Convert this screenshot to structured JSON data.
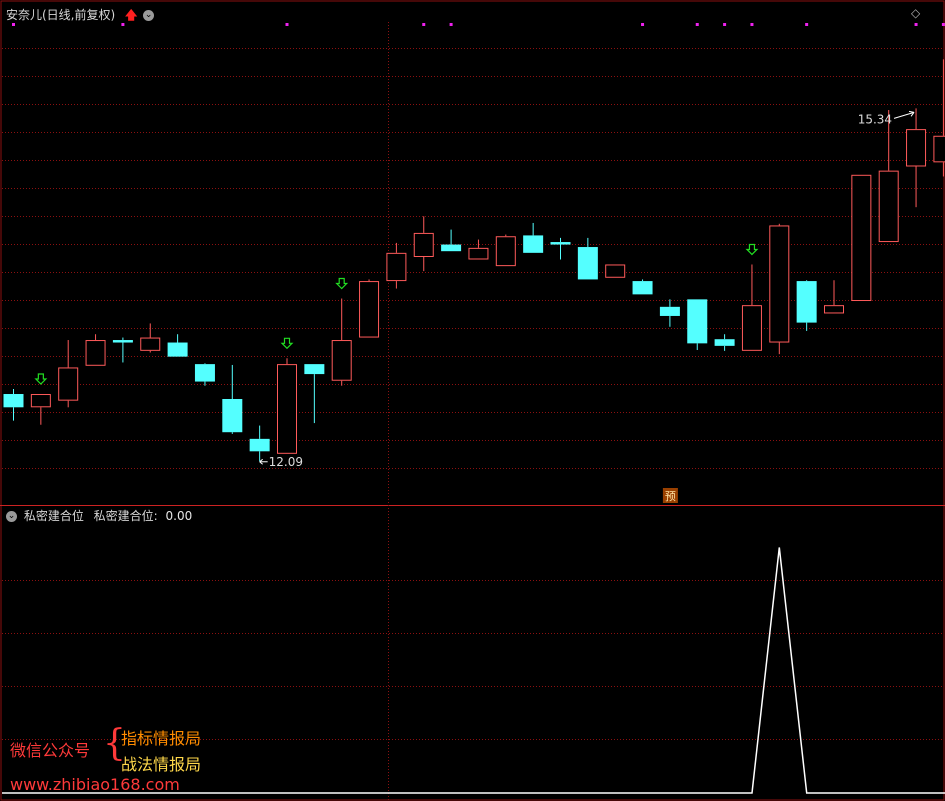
{
  "window": {
    "title": "安奈儿(日线,前复权)"
  },
  "indicator": {
    "name": "私密建合位",
    "value_label": "私密建合位:",
    "value": "0.00"
  },
  "colors": {
    "up": "#ff5a5a",
    "down": "#54ffff",
    "grid": "#8c1010",
    "signal": "#22dd22",
    "dot": "#ee22ee",
    "indicator_line": "#ffffff",
    "forecast_bg": "#9a4000",
    "forecast_fg": "#ffe0a0"
  },
  "chart_data": [
    {
      "type": "candlestick",
      "title": "安奈儿(日线,前复权)",
      "series": [
        {
          "o": 12.9,
          "c": 12.74,
          "h": 12.96,
          "l": 12.58
        },
        {
          "o": 12.74,
          "c": 12.9,
          "h": 12.9,
          "l": 12.53
        },
        {
          "o": 12.82,
          "c": 13.22,
          "h": 13.55,
          "l": 12.74
        },
        {
          "o": 13.24,
          "c": 13.55,
          "h": 13.62,
          "l": 13.24
        },
        {
          "o": 13.55,
          "c": 13.52,
          "h": 13.58,
          "l": 13.28
        },
        {
          "o": 13.42,
          "c": 13.58,
          "h": 13.75,
          "l": 13.4
        },
        {
          "o": 13.52,
          "c": 13.35,
          "h": 13.62,
          "l": 13.35
        },
        {
          "o": 13.26,
          "c": 13.05,
          "h": 13.27,
          "l": 13.0
        },
        {
          "o": 12.84,
          "c": 12.44,
          "h": 13.25,
          "l": 12.42
        },
        {
          "o": 12.36,
          "c": 12.21,
          "h": 12.52,
          "l": 12.09
        },
        {
          "o": 12.18,
          "c": 13.26,
          "h": 13.33,
          "l": 12.18
        },
        {
          "o": 13.26,
          "c": 13.14,
          "h": 13.26,
          "l": 12.55
        },
        {
          "o": 13.06,
          "c": 13.55,
          "h": 14.05,
          "l": 13.0
        },
        {
          "o": 13.58,
          "c": 14.26,
          "h": 14.28,
          "l": 13.58
        },
        {
          "o": 14.26,
          "c": 14.6,
          "h": 14.72,
          "l": 14.17
        },
        {
          "o": 14.55,
          "c": 14.84,
          "h": 15.04,
          "l": 14.38
        },
        {
          "o": 14.7,
          "c": 14.62,
          "h": 14.88,
          "l": 14.62
        },
        {
          "o": 14.52,
          "c": 14.66,
          "h": 14.76,
          "l": 14.52
        },
        {
          "o": 14.44,
          "c": 14.8,
          "h": 14.82,
          "l": 14.44
        },
        {
          "o": 14.81,
          "c": 14.6,
          "h": 14.96,
          "l": 14.6
        },
        {
          "o": 14.73,
          "c": 14.7,
          "h": 14.78,
          "l": 14.52
        },
        {
          "o": 14.67,
          "c": 14.28,
          "h": 14.78,
          "l": 14.28
        },
        {
          "o": 14.3,
          "c": 14.46,
          "h": 14.46,
          "l": 14.3
        },
        {
          "o": 14.26,
          "c": 14.1,
          "h": 14.28,
          "l": 14.1
        },
        {
          "o": 13.95,
          "c": 13.84,
          "h": 14.04,
          "l": 13.71
        },
        {
          "o": 14.04,
          "c": 13.51,
          "h": 14.04,
          "l": 13.43
        },
        {
          "o": 13.56,
          "c": 13.48,
          "h": 13.62,
          "l": 13.42
        },
        {
          "o": 13.42,
          "c": 13.97,
          "h": 14.46,
          "l": 13.42
        },
        {
          "o": 13.52,
          "c": 14.93,
          "h": 14.95,
          "l": 13.38
        },
        {
          "o": 14.26,
          "c": 13.76,
          "h": 14.27,
          "l": 13.66
        },
        {
          "o": 13.87,
          "c": 13.97,
          "h": 14.27,
          "l": 13.87
        },
        {
          "o": 14.02,
          "c": 15.54,
          "h": 15.54,
          "l": 14.02
        },
        {
          "o": 14.73,
          "c": 15.59,
          "h": 16.32,
          "l": 14.73
        },
        {
          "o": 15.64,
          "c": 16.09,
          "h": 16.34,
          "l": 15.15
        },
        {
          "o": 15.69,
          "c": 16.01,
          "h": 16.93,
          "l": 15.52
        },
        {
          "o": 15.94,
          "c": 16.78,
          "h": 16.86,
          "l": 15.8
        }
      ],
      "annotations": [
        {
          "label": "12.09",
          "bar": 9
        },
        {
          "label": "15.34",
          "bar": 33
        }
      ],
      "signal_bars": [
        1,
        10,
        12,
        27
      ],
      "top_marker_bars": [
        0,
        4,
        10,
        15,
        16,
        23,
        25,
        26,
        27,
        29,
        33,
        34
      ],
      "forecast_label": "预",
      "forecast_bar": 24,
      "ylim": [
        11.72,
        17.38
      ],
      "grid": true
    },
    {
      "type": "line",
      "title": "私密建合位",
      "values": [
        0,
        0,
        0,
        0,
        0,
        0,
        0,
        0,
        0,
        0,
        0,
        0,
        0,
        0,
        0,
        0,
        0,
        0,
        0,
        0,
        0,
        0,
        0,
        0,
        0,
        0,
        0,
        0,
        1,
        0,
        0,
        0,
        0,
        0,
        0,
        0
      ],
      "ylim": [
        0,
        1.1
      ],
      "grid": true
    }
  ],
  "watermark": {
    "line1": "微信公众号",
    "brace": "{",
    "line2": "指标情报局",
    "line3": "战法情报局",
    "url": "www.zhibiao168.com"
  }
}
